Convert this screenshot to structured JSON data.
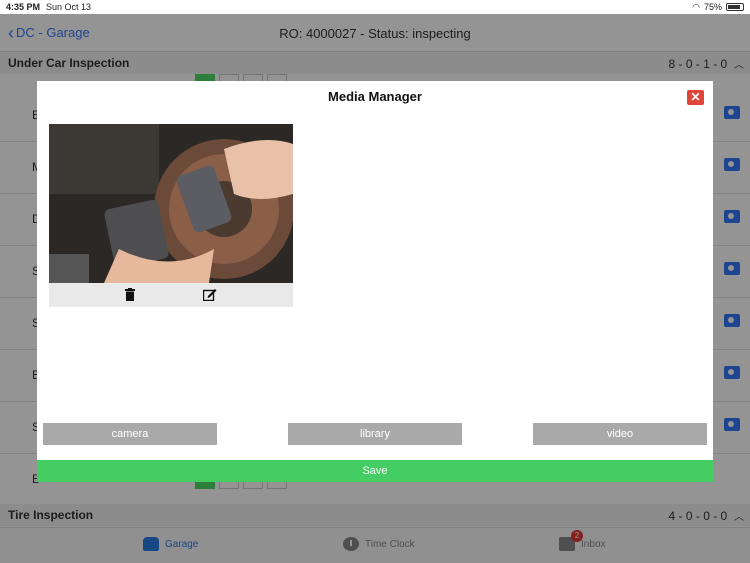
{
  "status_bar": {
    "time": "4:35 PM",
    "date": "Sun Oct 13",
    "battery": "75%",
    "battery_level": 0.75
  },
  "nav": {
    "back_label": "DC - Garage",
    "title": "RO: 4000027 - Status: inspecting"
  },
  "sections": [
    {
      "title": "Under Car Inspection",
      "counts": "8 - 0 - 1 - 0"
    },
    {
      "title": "Tire Inspection",
      "counts": "4 - 0 - 0 - 0"
    }
  ],
  "background_rows": [
    {
      "label": "B"
    },
    {
      "label": "M"
    },
    {
      "label": "D"
    },
    {
      "label": "S"
    },
    {
      "label": "S"
    },
    {
      "label": "B"
    },
    {
      "label": "S"
    },
    {
      "label": "B"
    }
  ],
  "modal": {
    "title": "Media Manager",
    "close_label": "✕",
    "buttons": {
      "camera": "camera",
      "library": "library",
      "video": "video"
    },
    "save_label": "Save",
    "thumbnail_icons": [
      "trash-icon",
      "edit-icon"
    ]
  },
  "tabs": [
    {
      "label": "Garage",
      "icon": "car-icon",
      "active": true
    },
    {
      "label": "Time Clock",
      "icon": "clock-icon",
      "active": false
    },
    {
      "label": "Inbox",
      "icon": "inbox-icon",
      "active": false,
      "badge": "2"
    }
  ],
  "colors": {
    "accent": "#2a7ae4",
    "save": "#43cd63",
    "close": "#e0453b",
    "button_gray": "#a9a9a9"
  }
}
